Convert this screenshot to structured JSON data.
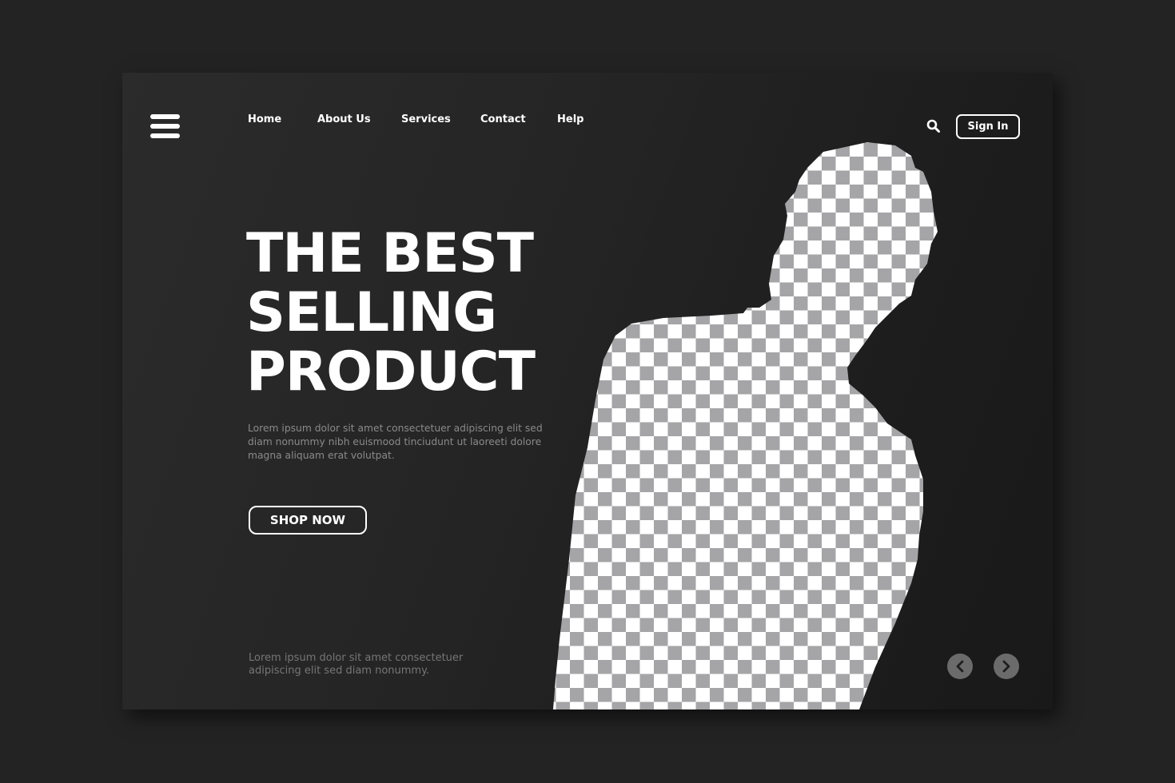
{
  "header": {
    "menu_icon": "hamburger-menu-icon",
    "nav": [
      {
        "label": "Home"
      },
      {
        "label": "About Us"
      },
      {
        "label": "Services"
      },
      {
        "label": "Contact"
      },
      {
        "label": "Help"
      }
    ],
    "search_icon": "search-icon",
    "signin_label": "Sign In"
  },
  "hero": {
    "headline_lines": [
      "THE BEST",
      "SELLING",
      "PRODUCT"
    ],
    "description": "Lorem ipsum dolor sit amet consectetuer adipiscing elit sed diam nonummy nibh euismood tinciudunt ut laoreeti dolore magna aliquam erat volutpat.",
    "cta_label": "SHOP NOW",
    "image_placeholder": "transparent-checkerboard-person-silhouette"
  },
  "footer": {
    "text": "Lorem ipsum dolor sit amet consectetuer adipiscing elit sed diam nonummy.",
    "prev_icon": "chevron-left-icon",
    "next_icon": "chevron-right-icon"
  },
  "colors": {
    "page_background": "#232323",
    "card_background": "#262626",
    "text_primary": "#ffffff",
    "text_muted": "#8a8a8a",
    "checker_light": "#ffffff",
    "checker_dark": "#a5a5a7",
    "arrow_button": "#6b6b6b"
  }
}
